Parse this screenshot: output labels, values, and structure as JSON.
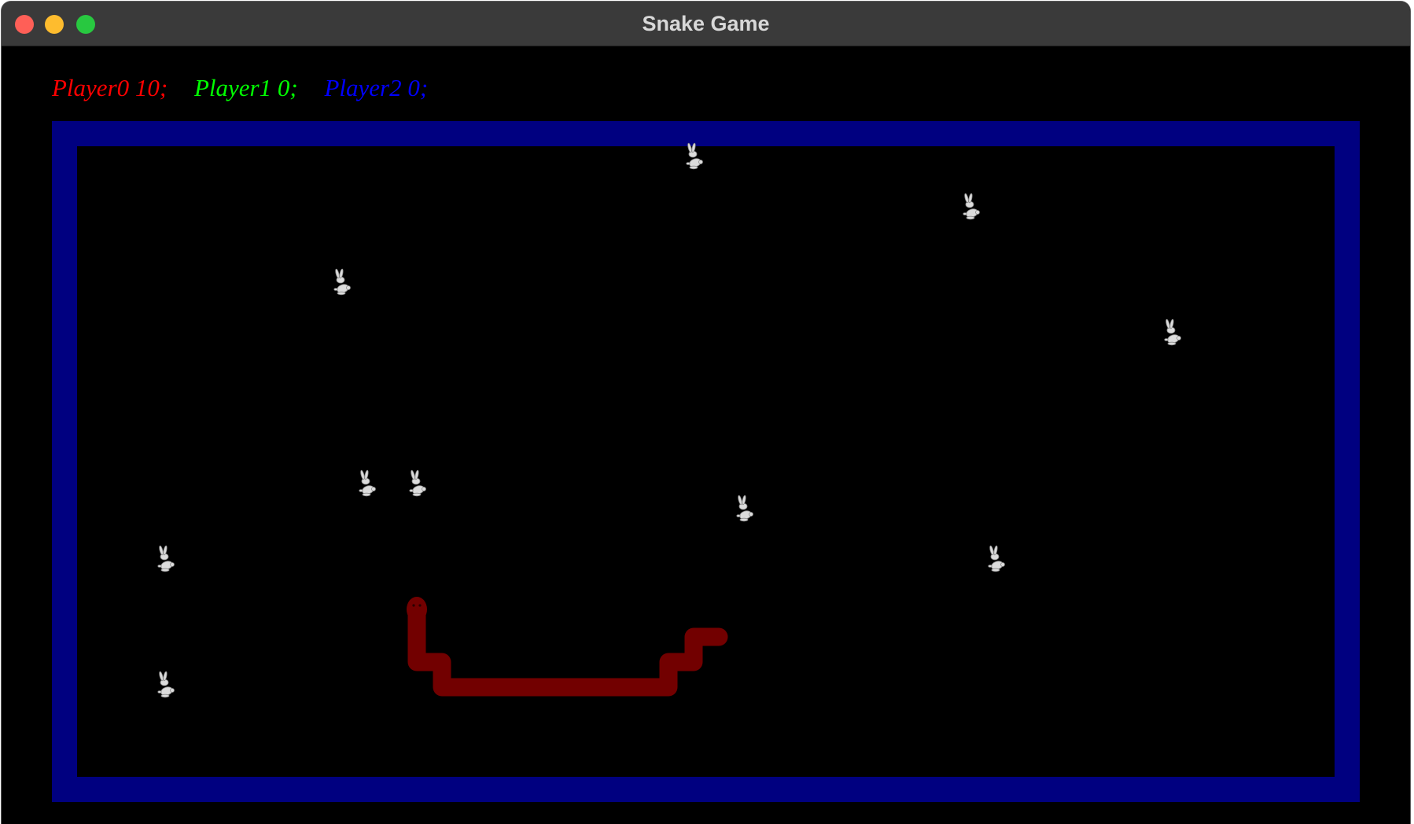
{
  "window": {
    "title": "Snake Game"
  },
  "scoreboard": {
    "players": [
      {
        "label": "Player0 10;",
        "color": "#ff0000"
      },
      {
        "label": "Player1 0;",
        "color": "#00ff00"
      },
      {
        "label": "Player2 0;",
        "color": "#0000ff"
      }
    ]
  },
  "colors": {
    "background": "#000000",
    "wall": "#000080",
    "snake": "#720000",
    "rabbit": "#dcdcdc"
  },
  "game": {
    "grid": {
      "cols": 50,
      "rows": 25
    },
    "rabbit_icon": "rabbit-icon",
    "rabbits": [
      {
        "col": 24,
        "row": 0
      },
      {
        "col": 35,
        "row": 2
      },
      {
        "col": 10,
        "row": 5
      },
      {
        "col": 43,
        "row": 7
      },
      {
        "col": 11,
        "row": 13
      },
      {
        "col": 13,
        "row": 13
      },
      {
        "col": 26,
        "row": 14
      },
      {
        "col": 3,
        "row": 16
      },
      {
        "col": 36,
        "row": 16
      },
      {
        "col": 3,
        "row": 21
      }
    ],
    "snake": {
      "head": {
        "col": 13,
        "row": 18
      },
      "cells": [
        {
          "col": 13,
          "row": 18
        },
        {
          "col": 13,
          "row": 19
        },
        {
          "col": 13,
          "row": 20
        },
        {
          "col": 14,
          "row": 20
        },
        {
          "col": 14,
          "row": 21
        },
        {
          "col": 15,
          "row": 21
        },
        {
          "col": 16,
          "row": 21
        },
        {
          "col": 17,
          "row": 21
        },
        {
          "col": 18,
          "row": 21
        },
        {
          "col": 19,
          "row": 21
        },
        {
          "col": 20,
          "row": 21
        },
        {
          "col": 21,
          "row": 21
        },
        {
          "col": 22,
          "row": 21
        },
        {
          "col": 23,
          "row": 21
        },
        {
          "col": 23,
          "row": 20
        },
        {
          "col": 24,
          "row": 20
        },
        {
          "col": 24,
          "row": 19
        },
        {
          "col": 25,
          "row": 19
        }
      ]
    }
  }
}
